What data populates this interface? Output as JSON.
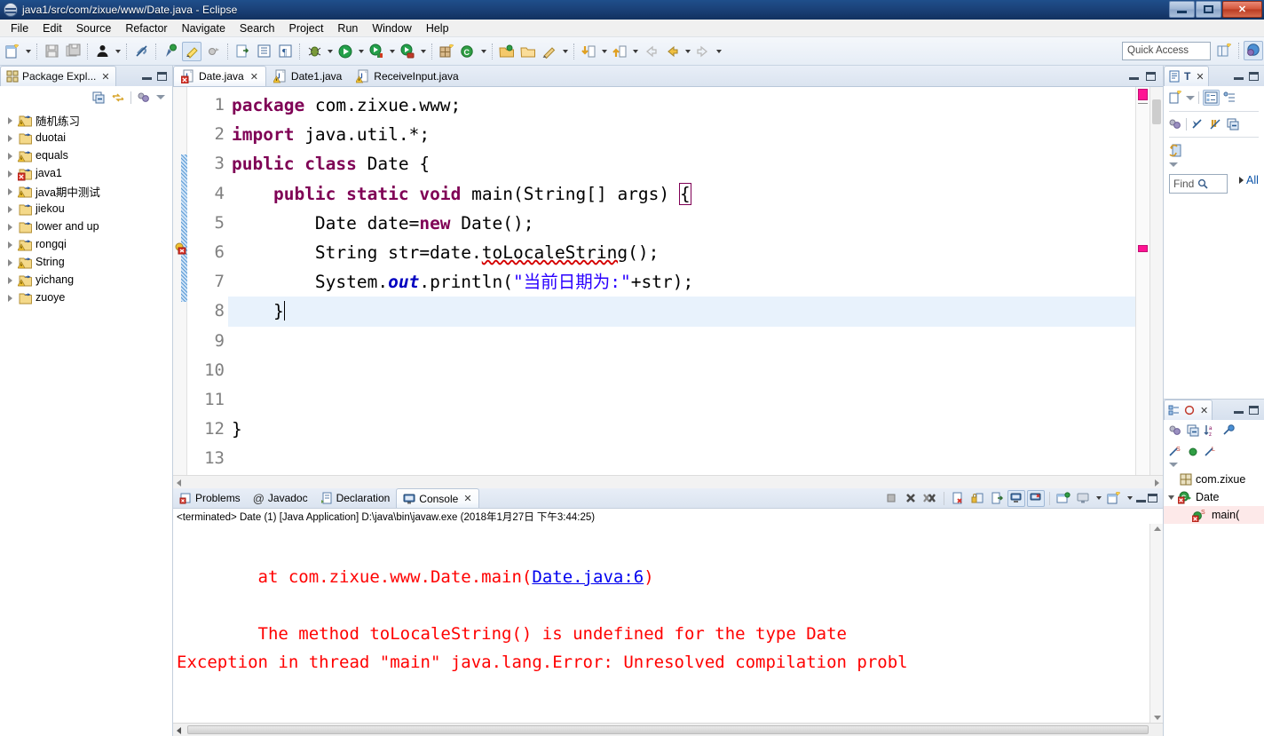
{
  "window": {
    "title": "java1/src/com/zixue/www/Date.java - Eclipse",
    "controls": {
      "minimize": "minimize-button",
      "maximize": "maximize-button",
      "close": "✕"
    }
  },
  "menubar": {
    "items": [
      "File",
      "Edit",
      "Source",
      "Refactor",
      "Navigate",
      "Search",
      "Project",
      "Run",
      "Window",
      "Help"
    ]
  },
  "toolbar": {
    "quick_access_placeholder": "Quick Access",
    "icons": [
      "new-wizard-icon",
      "save-icon",
      "save-all-icon",
      "person-icon",
      "link-disabled-icon",
      "toggle-mark-occurrences-icon",
      "highlight-icon",
      "skip-breakpoints-icon",
      "open-type-icon",
      "open-task-icon",
      "toggle-pilcrow-icon",
      "debug-icon",
      "run-icon",
      "run-external-tools-icon",
      "coverage-icon",
      "new-java-project-icon",
      "new-java-class-icon",
      "open-resource-icon",
      "open-package-icon",
      "edit-icon",
      "previous-annotation-icon",
      "next-annotation-icon",
      "back-icon",
      "forward-icon"
    ]
  },
  "package_explorer": {
    "tab_label": "Package Expl...",
    "close_glyph": "✕",
    "toolbar_icons": [
      "collapse-all-icon",
      "link-with-editor-icon",
      "view-menu-icon",
      "view-chevron-icon"
    ],
    "items": [
      {
        "label": "随机练习",
        "state": "warning"
      },
      {
        "label": "duotai",
        "state": "normal"
      },
      {
        "label": "equals",
        "state": "warning"
      },
      {
        "label": "java1",
        "state": "error"
      },
      {
        "label": "java期中测试",
        "state": "warning"
      },
      {
        "label": "jiekou",
        "state": "normal"
      },
      {
        "label": "lower and up",
        "state": "normal"
      },
      {
        "label": "rongqi",
        "state": "warning"
      },
      {
        "label": "String",
        "state": "warning"
      },
      {
        "label": "yichang",
        "state": "warning"
      },
      {
        "label": "zuoye",
        "state": "normal"
      }
    ]
  },
  "editor": {
    "tabs": [
      {
        "label": "Date.java",
        "active": true,
        "state": "error",
        "close_glyph": "✕"
      },
      {
        "label": "Date1.java",
        "active": false,
        "state": "warning"
      },
      {
        "label": "ReceiveInput.java",
        "active": false,
        "state": "warning"
      }
    ],
    "line_numbers": [
      "1",
      "2",
      "3",
      "4",
      "5",
      "6",
      "7",
      "8",
      "9",
      "10",
      "11",
      "12",
      "13"
    ],
    "lines": [
      {
        "n": 1,
        "segments": [
          {
            "t": "package",
            "c": "kw"
          },
          {
            "t": " com.zixue.www;",
            "c": ""
          }
        ]
      },
      {
        "n": 2,
        "segments": [
          {
            "t": "import",
            "c": "kw"
          },
          {
            "t": " java.util.*;",
            "c": ""
          }
        ]
      },
      {
        "n": 3,
        "segments": [
          {
            "t": "public",
            "c": "kw"
          },
          {
            "t": " ",
            "c": ""
          },
          {
            "t": "class",
            "c": "kw"
          },
          {
            "t": " Date {",
            "c": ""
          }
        ]
      },
      {
        "n": 4,
        "segments": [
          {
            "t": "    ",
            "c": ""
          },
          {
            "t": "public",
            "c": "kw"
          },
          {
            "t": " ",
            "c": ""
          },
          {
            "t": "static",
            "c": "kw"
          },
          {
            "t": " ",
            "c": ""
          },
          {
            "t": "void",
            "c": "kw"
          },
          {
            "t": " main(String[] args) ",
            "c": ""
          },
          {
            "t": "{",
            "c": "brace"
          }
        ]
      },
      {
        "n": 5,
        "segments": [
          {
            "t": "        Date date=",
            "c": ""
          },
          {
            "t": "new",
            "c": "kw"
          },
          {
            "t": " Date();",
            "c": ""
          }
        ]
      },
      {
        "n": 6,
        "segments": [
          {
            "t": "        String str=date.",
            "c": ""
          },
          {
            "t": "toLocaleString",
            "c": "errw"
          },
          {
            "t": "();",
            "c": ""
          }
        ]
      },
      {
        "n": 7,
        "segments": [
          {
            "t": "        System.",
            "c": ""
          },
          {
            "t": "out",
            "c": "fld"
          },
          {
            "t": ".println(",
            "c": ""
          },
          {
            "t": "\"当前日期为:\"",
            "c": "str"
          },
          {
            "t": "+str);",
            "c": ""
          }
        ]
      },
      {
        "n": 8,
        "segments": [
          {
            "t": "    }",
            "c": ""
          }
        ],
        "highlight": true,
        "caret": true
      },
      {
        "n": 9,
        "segments": []
      },
      {
        "n": 10,
        "segments": []
      },
      {
        "n": 11,
        "segments": []
      },
      {
        "n": 12,
        "segments": [
          {
            "t": "}",
            "c": ""
          }
        ]
      },
      {
        "n": 13,
        "segments": []
      }
    ]
  },
  "console": {
    "tabs": [
      {
        "label": "Problems",
        "icon": "problems-icon",
        "active": false
      },
      {
        "label": "Javadoc",
        "icon": "javadoc-icon",
        "active": false
      },
      {
        "label": "Declaration",
        "icon": "declaration-icon",
        "active": false
      },
      {
        "label": "Console",
        "icon": "console-icon",
        "active": true,
        "close_glyph": "✕"
      }
    ],
    "toolbar_icons": [
      "terminate-icon",
      "remove-launch-icon",
      "remove-all-terminated-icon",
      "clear-console-icon",
      "scroll-lock-icon",
      "show-console-on-output-icon",
      "pin-console-icon",
      "display-selected-console-icon",
      "open-console-icon"
    ],
    "status_line": "<terminated> Date (1) [Java Application] D:\\java\\bin\\javaw.exe (2018年1月27日 下午3:44:25)",
    "output_lines": [
      {
        "text": "Exception in thread \"main\" java.lang.Error: Unresolved compilation probl",
        "link": null
      },
      {
        "text": "        The method toLocaleString() is undefined for the type Date",
        "link": null
      },
      {
        "text": "",
        "link": null
      },
      {
        "pre": "        at com.zixue.www.Date.main(",
        "link": "Date.java:6",
        "post": ")"
      }
    ]
  },
  "right_panel": {
    "top": {
      "tabs": [
        "task-list-icon",
        "templates-icon"
      ],
      "close_glyph": "✕",
      "find_placeholder": "Find",
      "find_icon": "search-icon",
      "all_label": "All",
      "toolbar_icons": [
        "new-task-icon",
        "categorize-icon",
        "flat-presentation-icon",
        "focus-icon",
        "filter-icon",
        "collapse-all-icon",
        "synchronize-icon",
        "view-chevron-icon"
      ]
    },
    "bottom": {
      "tabs": [
        "outline-icon",
        "type-hierarchy-icon"
      ],
      "close_glyph": "✕",
      "toolbar_icons": [
        "focus-icon",
        "collapse-all-icon",
        "sort-icon",
        "hide-fields-icon",
        "hide-static-icon",
        "hide-nonpublic-icon",
        "hide-local-icon",
        "view-chevron-icon"
      ],
      "items": [
        {
          "label": "com.zixue",
          "kind": "package",
          "indent": 1,
          "selected": false
        },
        {
          "label": "Date",
          "kind": "class-error",
          "indent": 0,
          "selected": false
        },
        {
          "label": "main(",
          "kind": "method-error-static",
          "indent": 2,
          "selected": true
        }
      ]
    }
  }
}
